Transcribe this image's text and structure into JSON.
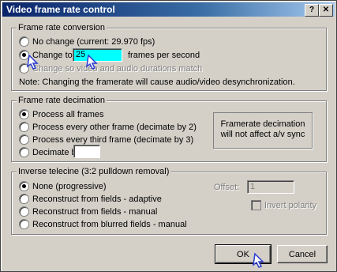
{
  "window": {
    "title": "Video frame rate control",
    "help_btn": "?",
    "close_btn": "✕"
  },
  "frc": {
    "legend": "Frame rate conversion",
    "options": [
      "No change (current: 29.970 fps)",
      "Change to",
      "Change so video and audio durations match"
    ],
    "change_value": "25",
    "change_suffix": "frames per second",
    "note": "Note: Changing the framerate will cause audio/video desynchronization."
  },
  "decim": {
    "legend": "Frame rate decimation",
    "options": [
      "Process all frames",
      "Process every other frame (decimate by 2)",
      "Process every third frame (decimate by 3)",
      "Decimate by"
    ],
    "decimate_value": "",
    "info": "Framerate decimation will not affect a/v sync"
  },
  "ivtc": {
    "legend": "Inverse telecine (3:2 pulldown removal)",
    "options": [
      "None (progressive)",
      "Reconstruct from fields - adaptive",
      "Reconstruct from fields - manual",
      "Reconstruct from blurred fields - manual"
    ],
    "offset_label": "Offset:",
    "offset_value": "1",
    "invert_label": "Invert polarity"
  },
  "buttons": {
    "ok": "OK",
    "cancel": "Cancel"
  }
}
